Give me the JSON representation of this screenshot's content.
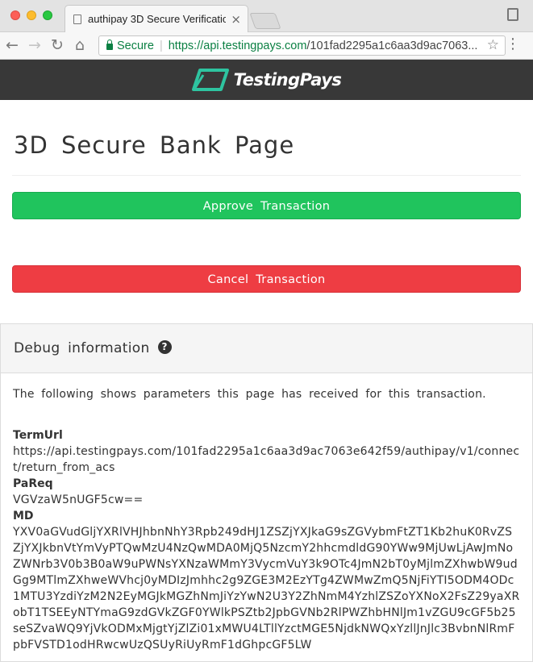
{
  "browser": {
    "tab_title": "authipay 3D Secure Verificatio",
    "tab_close": "×",
    "secure_label": "Secure",
    "url_main": "https://api.testingpays.com",
    "url_rest": "/101fad2295a1c6aa3d9ac7063...",
    "back_icon": "←",
    "forward_icon": "→",
    "reload_icon": "↻",
    "home_icon": "⌂",
    "star_icon": "☆",
    "menu_icon": "⋮"
  },
  "brand": {
    "name": "TestingPays",
    "accent": "#2ec4a0",
    "bar_color": "#383838"
  },
  "page": {
    "title": "3D Secure Bank Page",
    "approve_label": "Approve Transaction",
    "cancel_label": "Cancel Transaction",
    "approve_color": "#20c45d",
    "cancel_color": "#ee3d43"
  },
  "debug": {
    "title": "Debug information",
    "help_icon": "?",
    "intro": "The following shows parameters this page has received for this transaction.",
    "params": [
      {
        "name": "TermUrl",
        "value": "https://api.testingpays.com/101fad2295a1c6aa3d9ac7063e642f59/authipay/v1/connect/return_from_acs"
      },
      {
        "name": "PaReq",
        "value": "VGVzaW5nUGF5cw=="
      },
      {
        "name": "MD",
        "value": "YXV0aGVudGljYXRlVHJhbnNhY3Rpb249dHJ1ZSZjYXJkaG9sZGVybmFtZT1Kb2huK0RvZSZjYXJkbnVtYmVyPTQwMzU4NzQwMDA0MjQ5NzcmY2hhcmdldG90YWw9MjUwLjAwJmNoZWNrb3V0b3B0aW9uPWNsYXNzaWMmY3VycmVuY3k9OTc4JmN2bT0yMjlmZXhwbW9udGg9MTlmZXhweWVhcj0yMDIzJmhhc2g9ZGE3M2EzYTg4ZWMwZmQ5NjFiYTI5ODM4ODc1MTU3YzdiYzM2N2EyMGJkMGZhNmJiYzYwN2U3Y2ZhNmM4YzhlZSZoYXNoX2FsZ29yaXRobT1TSEEyNTYmaG9zdGVkZGF0YWlkPSZtb2JpbGVNb2RlPWZhbHNlJm1vZGU9cGF5b25seSZvaWQ9YjVkODMxMjgtYjZlZi01xMWU4LTllYzctMGE5NjdkNWQxYzllJnJlc3BvbnNlRmFpbFVSTD1odHRwcwUzQSUyRiUyRmF1dGhpcGF5LW"
      }
    ]
  }
}
